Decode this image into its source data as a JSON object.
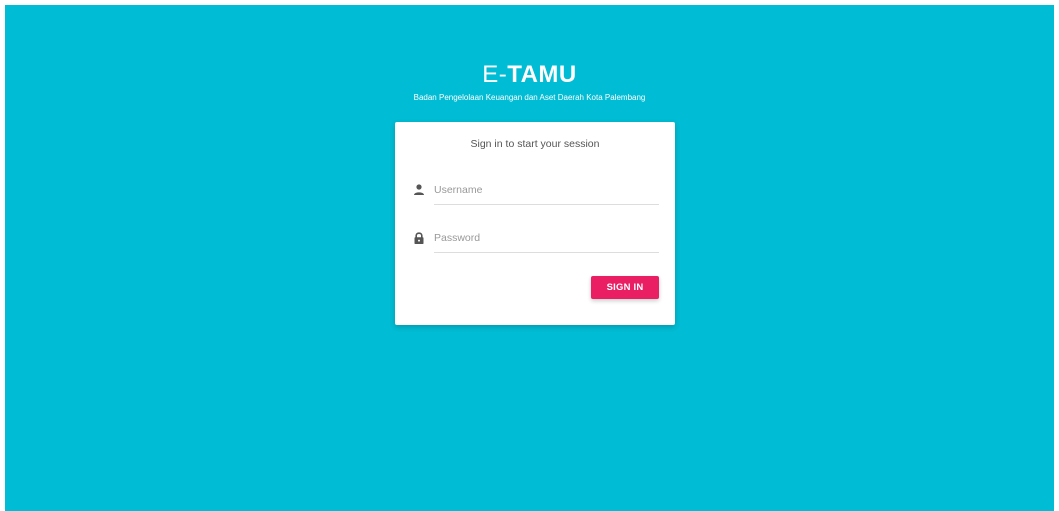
{
  "brand": {
    "title_prefix": "E-",
    "title_bold": "TAMU",
    "subtitle": "Badan Pengelolaan Keuangan dan Aset Daerah Kota Palembang"
  },
  "login": {
    "message": "Sign in to start your session",
    "username_placeholder": "Username",
    "password_placeholder": "Password",
    "username_icon": "person-icon",
    "password_icon": "lock-icon",
    "submit_label": "SIGN IN"
  },
  "colors": {
    "background": "#00bcd4",
    "accent": "#e91e63",
    "card": "#ffffff"
  }
}
